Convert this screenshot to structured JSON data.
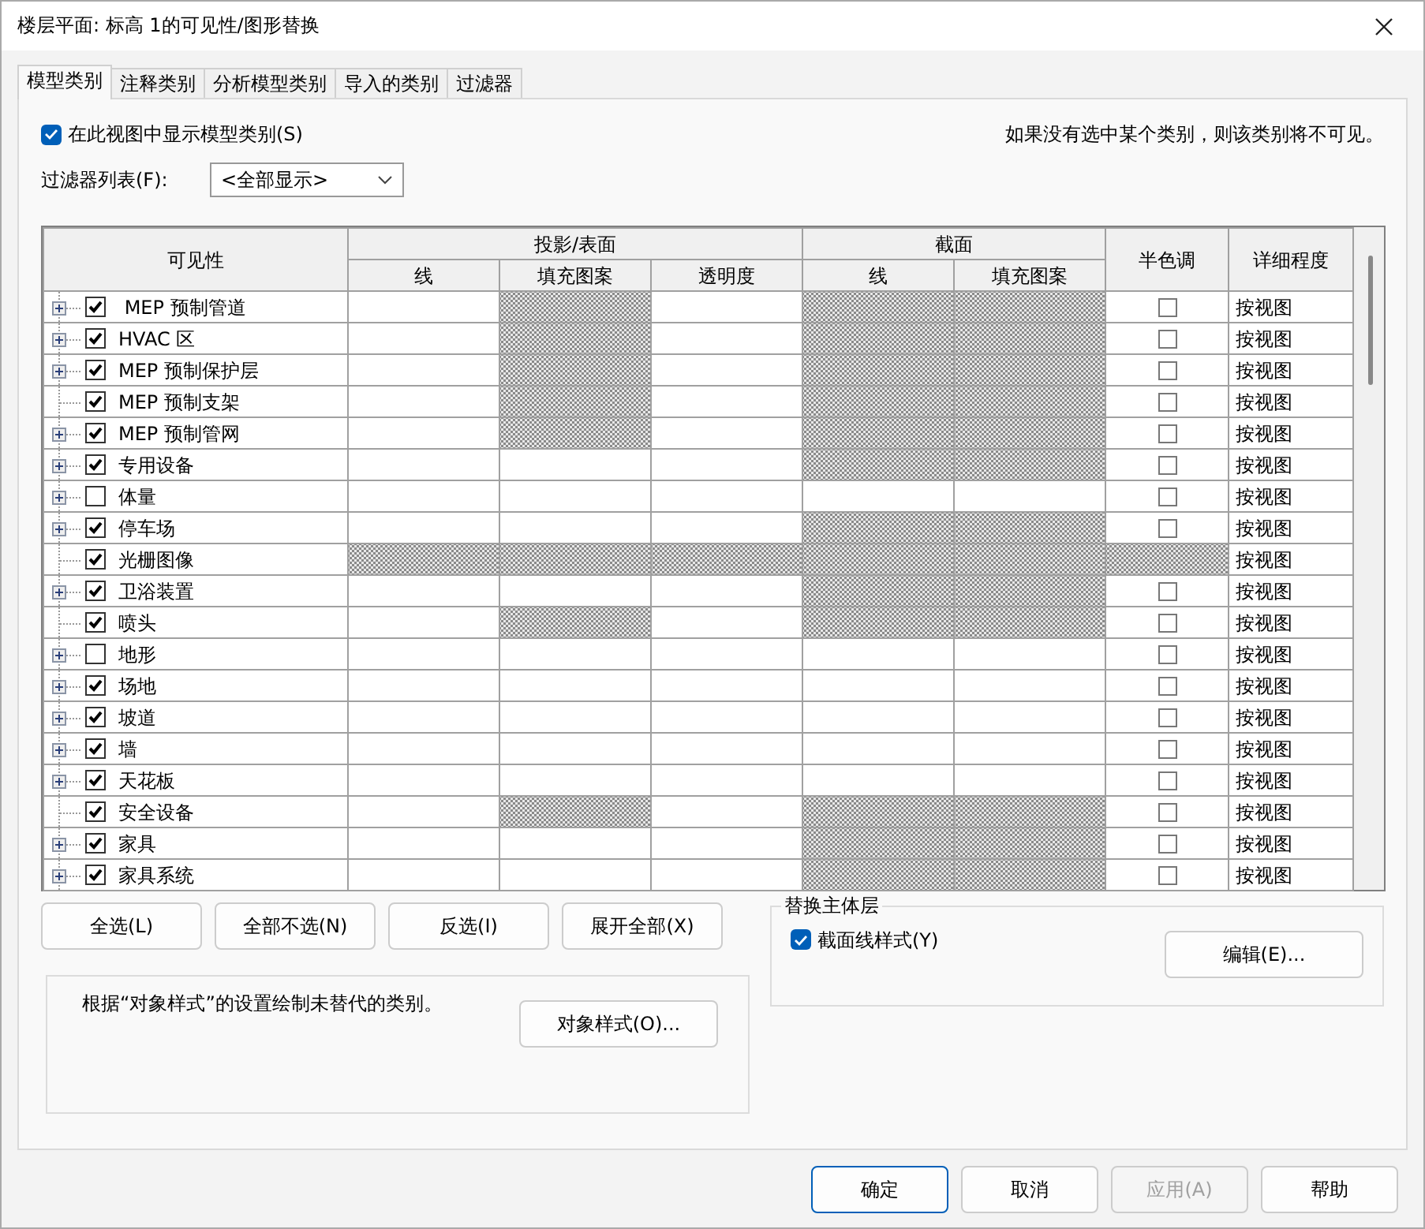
{
  "window": {
    "title": "楼层平面: 标高 1的可见性/图形替换"
  },
  "tabs": [
    {
      "label": "模型类别",
      "selected": true
    },
    {
      "label": "注释类别",
      "selected": false
    },
    {
      "label": "分析模型类别",
      "selected": false
    },
    {
      "label": "导入的类别",
      "selected": false
    },
    {
      "label": "过滤器",
      "selected": false
    }
  ],
  "show_categories": {
    "label": "在此视图中显示模型类别(S)",
    "checked": true
  },
  "note": "如果没有选中某个类别，则该类别将不可见。",
  "filter_list": {
    "label": "过滤器列表(F):",
    "value": "<全部显示>"
  },
  "table": {
    "header": {
      "visibility": "可见性",
      "projection": {
        "label": "投影/表面",
        "columns": [
          "线",
          "填充图案",
          "透明度"
        ]
      },
      "cut": {
        "label": "截面",
        "columns": [
          "线",
          "填充图案"
        ]
      },
      "halftone": "半色调",
      "detail": "详细程度"
    },
    "rows": [
      {
        "name": " MEP 预制管道",
        "checked": true,
        "expandable": true,
        "hatched": [
          false,
          true,
          false,
          true,
          true,
          false
        ],
        "halftone": false,
        "detail": "按视图"
      },
      {
        "name": "HVAC 区",
        "checked": true,
        "expandable": true,
        "hatched": [
          false,
          true,
          false,
          true,
          true,
          false
        ],
        "halftone": false,
        "detail": "按视图"
      },
      {
        "name": "MEP 预制保护层",
        "checked": true,
        "expandable": true,
        "hatched": [
          false,
          true,
          false,
          true,
          true,
          false
        ],
        "halftone": false,
        "detail": "按视图"
      },
      {
        "name": "MEP 预制支架",
        "checked": true,
        "expandable": false,
        "hatched": [
          false,
          true,
          false,
          true,
          true,
          false
        ],
        "halftone": false,
        "detail": "按视图"
      },
      {
        "name": "MEP 预制管网",
        "checked": true,
        "expandable": true,
        "hatched": [
          false,
          true,
          false,
          true,
          true,
          false
        ],
        "halftone": false,
        "detail": "按视图"
      },
      {
        "name": "专用设备",
        "checked": true,
        "expandable": true,
        "hatched": [
          false,
          false,
          false,
          true,
          true,
          false
        ],
        "halftone": false,
        "detail": "按视图"
      },
      {
        "name": "体量",
        "checked": false,
        "expandable": true,
        "hatched": [
          false,
          false,
          false,
          false,
          false,
          false
        ],
        "halftone": false,
        "detail": "按视图"
      },
      {
        "name": "停车场",
        "checked": true,
        "expandable": true,
        "hatched": [
          false,
          false,
          false,
          true,
          true,
          false
        ],
        "halftone": false,
        "detail": "按视图"
      },
      {
        "name": "光栅图像",
        "checked": true,
        "expandable": false,
        "hatched": [
          true,
          true,
          true,
          true,
          true,
          true
        ],
        "detail": "按视图"
      },
      {
        "name": "卫浴装置",
        "checked": true,
        "expandable": true,
        "hatched": [
          false,
          false,
          false,
          true,
          true,
          false
        ],
        "halftone": false,
        "detail": "按视图"
      },
      {
        "name": "喷头",
        "checked": true,
        "expandable": false,
        "hatched": [
          false,
          true,
          false,
          true,
          true,
          false
        ],
        "halftone": false,
        "detail": "按视图"
      },
      {
        "name": "地形",
        "checked": false,
        "expandable": true,
        "hatched": [
          false,
          false,
          false,
          false,
          false,
          false
        ],
        "halftone": false,
        "detail": "按视图"
      },
      {
        "name": "场地",
        "checked": true,
        "expandable": true,
        "hatched": [
          false,
          false,
          false,
          false,
          false,
          false
        ],
        "halftone": false,
        "detail": "按视图"
      },
      {
        "name": "坡道",
        "checked": true,
        "expandable": true,
        "hatched": [
          false,
          false,
          false,
          false,
          false,
          false
        ],
        "halftone": false,
        "detail": "按视图"
      },
      {
        "name": "墙",
        "checked": true,
        "expandable": true,
        "hatched": [
          false,
          false,
          false,
          false,
          false,
          false
        ],
        "halftone": false,
        "detail": "按视图"
      },
      {
        "name": "天花板",
        "checked": true,
        "expandable": true,
        "hatched": [
          false,
          false,
          false,
          false,
          false,
          false
        ],
        "halftone": false,
        "detail": "按视图"
      },
      {
        "name": "安全设备",
        "checked": true,
        "expandable": false,
        "hatched": [
          false,
          true,
          false,
          true,
          true,
          false
        ],
        "halftone": false,
        "detail": "按视图"
      },
      {
        "name": "家具",
        "checked": true,
        "expandable": true,
        "hatched": [
          false,
          false,
          false,
          true,
          true,
          false
        ],
        "halftone": false,
        "detail": "按视图"
      },
      {
        "name": "家具系统",
        "checked": true,
        "expandable": true,
        "hatched": [
          false,
          false,
          false,
          true,
          true,
          false
        ],
        "halftone": false,
        "detail": "按视图"
      }
    ]
  },
  "row_buttons": [
    "全选(L)",
    "全部不选(N)",
    "反选(I)",
    "展开全部(X)"
  ],
  "object_styles": {
    "text": "根据“对象样式”的设置绘制未替代的类别。",
    "button": "对象样式(O)..."
  },
  "host_layers": {
    "title": "替换主体层",
    "checkbox": {
      "label": "截面线样式(Y)",
      "checked": true
    },
    "button": "编辑(E)..."
  },
  "footer_buttons": [
    {
      "label": "确定",
      "default": true,
      "disabled": false
    },
    {
      "label": "取消",
      "default": false,
      "disabled": false
    },
    {
      "label": "应用(A)",
      "default": false,
      "disabled": true
    },
    {
      "label": "帮助",
      "default": false,
      "disabled": false
    }
  ]
}
